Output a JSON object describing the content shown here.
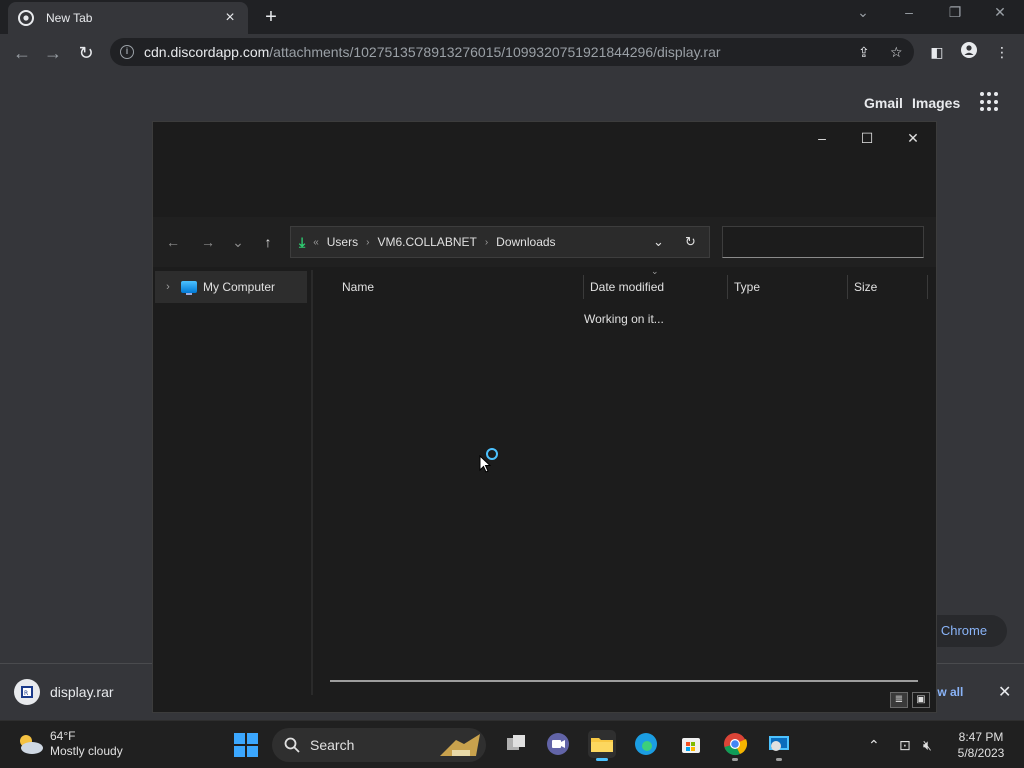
{
  "browser": {
    "tab_title": "New Tab",
    "url_host": "cdn.discordapp.com",
    "url_path": "/attachments/1027513578913276015/1099320751921844296/display.rar",
    "ntp_links": [
      "Gmail",
      "Images"
    ],
    "customize_label": "e Chrome",
    "download_file": "display.rar",
    "show_all_label": "ow all"
  },
  "dialog": {
    "breadcrumb_overflow": "«",
    "breadcrumb": [
      "Users",
      "VM6.COLLABNET",
      "Downloads"
    ],
    "search_placeholder": "",
    "tree_item": "My Computer",
    "columns": [
      "Name",
      "Date modified",
      "Type",
      "Size"
    ],
    "status": "Working on it..."
  },
  "taskbar": {
    "weather_temp": "64°F",
    "weather_desc": "Mostly cloudy",
    "search_label": "Search",
    "time": "8:47 PM",
    "date": "5/8/2023"
  },
  "colors": {
    "accent": "#4cc2ff",
    "chrome_link": "#8ab4f8",
    "dialog_bg": "#1c1c1c"
  }
}
